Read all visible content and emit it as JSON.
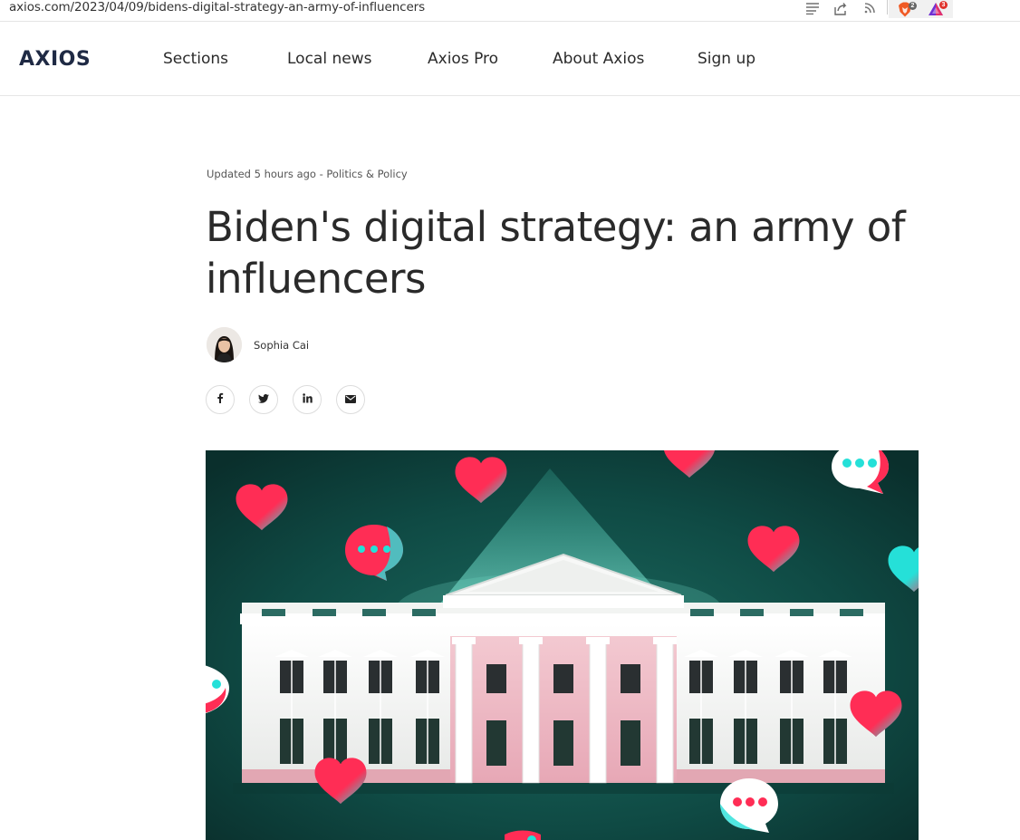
{
  "browser": {
    "url": "axios.com/2023/04/09/bidens-digital-strategy-an-army-of-influencers",
    "icons": [
      "reader-mode-icon",
      "share-icon",
      "rss-icon",
      "brave-shields-icon",
      "brave-rewards-icon"
    ],
    "brave_shields_count": "2",
    "brave_rewards_count": "3"
  },
  "header": {
    "logo": "AXIOS",
    "nav": [
      "Sections",
      "Local news",
      "Axios Pro",
      "About Axios",
      "Sign up"
    ]
  },
  "article": {
    "meta": "Updated 5 hours ago - Politics & Policy",
    "title": "Biden's digital strategy: an army of influencers",
    "author": "Sophia Cai",
    "share_icons": [
      "facebook-icon",
      "twitter-icon",
      "linkedin-icon",
      "email-icon"
    ]
  },
  "colors": {
    "brand_navy": "#1f2a44",
    "hero_background": "#0f4a44",
    "heart_red": "#ff2d55",
    "heart_cyan": "#25e0d8"
  }
}
